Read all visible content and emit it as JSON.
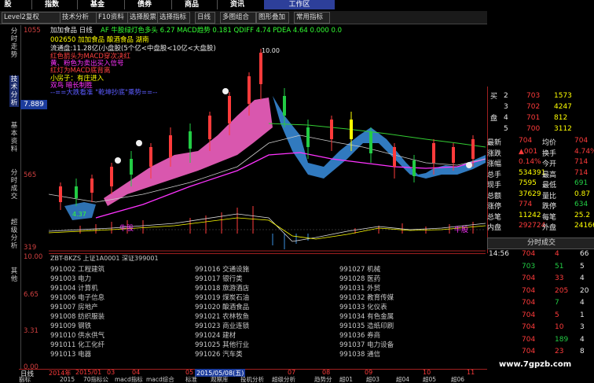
{
  "topmenu": [
    "股",
    "指数",
    "基金",
    "债券",
    "商品",
    "资讯",
    "工作区"
  ],
  "toolbar": [
    "Level2复权",
    "技术分析",
    "F10资料",
    "选择股票",
    "选择指标",
    "日线",
    "多图组合",
    "图形叠加",
    "常用指标"
  ],
  "stock": {
    "code_name": "加加食品 日线",
    "title_line": "002650 加加食品 酿酒食品 湖南",
    "circ_line": "流通盘:11.28亿(小盘股(5个亿<中盘股<10亿<大盘股)",
    "note1": "红色箭头为MACD穿次决红",
    "note2": "黄、粉色为卖出买入信号",
    "note3": "红灯为MACD底背离",
    "note4": "小房子：有庄进入",
    "note5": "双鸟 暗长制胜",
    "note6": "--==大跌看准 \"乾坤抄底\"乘势==--",
    "indicator_header": "AF 牛股绿灯色多头 6.27 MACD趋势 0.181 QDIFF 4.74 PDEA 4.64 0.000 0.0"
  },
  "axis": {
    "y1": "1055",
    "y2": "7.889",
    "y3": "565",
    "y4": "319",
    "y5": "10.00",
    "y6": "6.65",
    "y7": "3.31",
    "y8": "0.00",
    "peak": "10.00",
    "mark": "4.37"
  },
  "sidetabs": [
    "分时走势",
    "技术分析",
    "基本资料",
    "分时成交",
    "超级分析",
    "其他"
  ],
  "orderbook": [
    {
      "side": "买",
      "lvl": "2",
      "price": "703",
      "vol": "1573"
    },
    {
      "side": "",
      "lvl": "3",
      "price": "702",
      "vol": "4247"
    },
    {
      "side": "盘",
      "lvl": "4",
      "price": "701",
      "vol": "812"
    },
    {
      "side": "",
      "lvl": "5",
      "price": "700",
      "vol": "3112"
    }
  ],
  "stats": [
    {
      "l1": "最新",
      "v1": "704",
      "l2": "均价",
      "v2": "704"
    },
    {
      "l1": "涨跌",
      "v1": "▲001",
      "l2": "换手",
      "v2": "4.74%"
    },
    {
      "l1": "涨幅",
      "v1": "0.14%",
      "l2": "今开",
      "v2": "714"
    },
    {
      "l1": "总手",
      "v1": "534391",
      "l2": "最高",
      "v2": "714"
    },
    {
      "l1": "现手",
      "v1": "7595",
      "l2": "最低",
      "v2": "691"
    },
    {
      "l1": "总额",
      "v1": "37629",
      "l2": "量比",
      "v2": "0.87"
    },
    {
      "l1": "涨停",
      "v1": "774",
      "l2": "跌停",
      "v2": "634"
    },
    {
      "l1": "总笔",
      "v1": "11242",
      "l2": "每笔",
      "v2": "25.2"
    },
    {
      "l1": "内盘",
      "v1": "292724",
      "l2": "外盘",
      "v2": "241667"
    }
  ],
  "ticks_header": "分时成交",
  "ticks": [
    {
      "t": "14:56",
      "p": "704",
      "d": "4",
      "v": "66"
    },
    {
      "t": "",
      "p": "703",
      "d": "51",
      "v": "5"
    },
    {
      "t": "",
      "p": "704",
      "d": "33",
      "v": "4"
    },
    {
      "t": "",
      "p": "704",
      "d": "205",
      "v": "20"
    },
    {
      "t": "",
      "p": "704",
      "d": "7",
      "v": "4"
    },
    {
      "t": "",
      "p": "704",
      "d": "5",
      "v": "1"
    },
    {
      "t": "",
      "p": "704",
      "d": "10",
      "v": "3"
    },
    {
      "t": "",
      "p": "704",
      "d": "189",
      "v": "4"
    },
    {
      "t": "",
      "p": "704",
      "d": "23",
      "v": "8"
    }
  ],
  "sector_header": "ZBT-BKZS  上证1A0001  深证399001",
  "sectors": [
    [
      "991002 工程建筑",
      "991016 交通设施",
      "991027 机械"
    ],
    [
      "991003 电力",
      "991017 银行类",
      "991028 医药"
    ],
    [
      "991004 计算机",
      "991018 旅游酒店",
      "991031 外贸"
    ],
    [
      "991006 电子信息",
      "991019 煤炭石油",
      "991032 教育传媒"
    ],
    [
      "991007 房地产",
      "991020 酿酒食品",
      "991033 化仪表"
    ],
    [
      "991008 纺织服装",
      "991021 农林牧鱼",
      "991034 有色金属"
    ],
    [
      "991009 钢铁",
      "991023 商业连锁",
      "991035 造纸印刷"
    ],
    [
      "991010 供水供气",
      "991024 建材",
      "991036 券商"
    ],
    [
      "991011 化工化纤",
      "991025 其他行业",
      "991037 电力设备"
    ],
    [
      "991013 电器",
      "991026 汽车类",
      "991038 通信"
    ]
  ],
  "timeline": {
    "label": "日线",
    "y1": "2014年",
    "m1": "2015/01",
    "m2": "03",
    "m3": "04",
    "m4": "05",
    "date": "2015/05/08(五)",
    "m6": "07",
    "m7": "08",
    "m8": "09",
    "m9": "10",
    "m10": "11"
  },
  "bottomtabs": [
    "指标",
    "2015",
    "70指标公",
    "macd指标",
    "macd综合",
    "标准",
    "观察库",
    "投机分析",
    "超级分析",
    "趋势分",
    "超01",
    "超03",
    "超04",
    "超05",
    "超06"
  ],
  "watermark": "www.7gpzb.com",
  "labels": {
    "niu1": "牛股",
    "niu2": "牛股",
    "buy": "卖"
  }
}
